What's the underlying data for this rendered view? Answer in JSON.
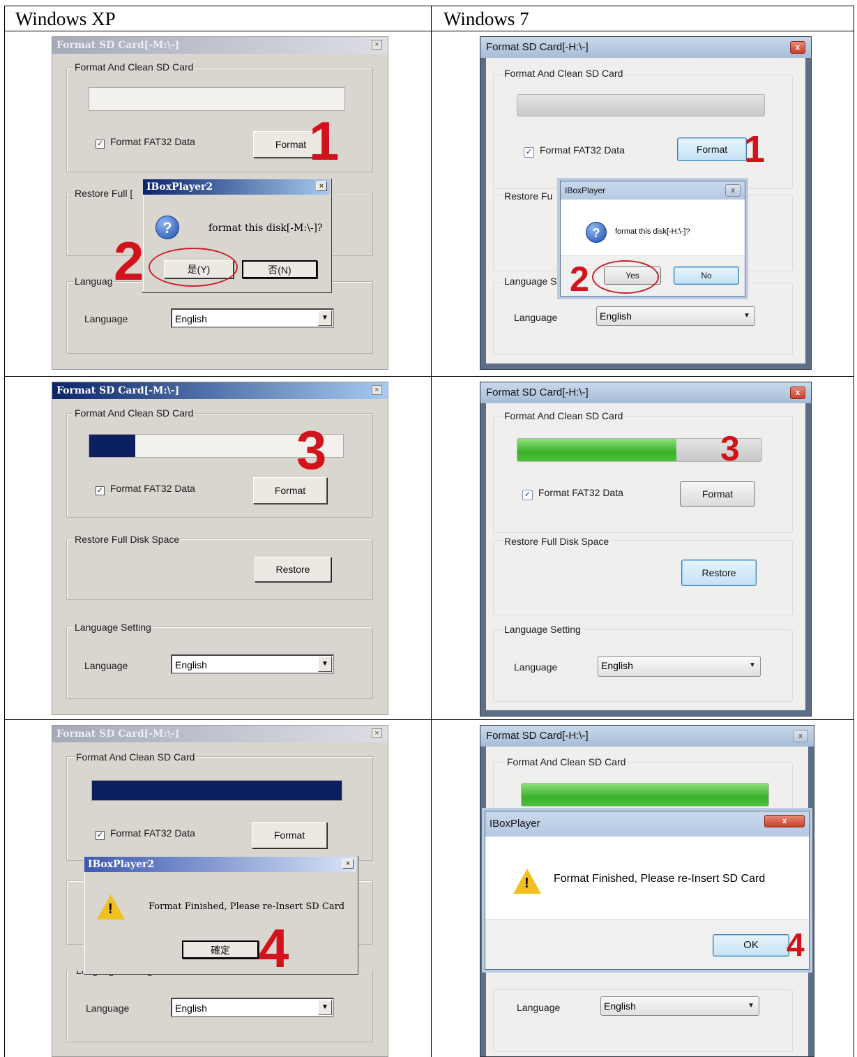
{
  "table": {
    "col_xp": "Windows XP",
    "col_w7": "Windows 7"
  },
  "xp": {
    "title": "Format SD Card[-M:\\-]",
    "group_format": "Format And Clean SD Card",
    "group_restore": "Restore Full Disk Space",
    "group_restore_partial": "Restore Full [",
    "group_language": "Language Setting",
    "group_language_partial1": "Languag",
    "group_language_partial3": "Language Setting",
    "checkbox_label": "Format FAT32 Data",
    "format_btn": "Format",
    "restore_btn": "Restore",
    "language_label": "Language",
    "language_value": "English",
    "progress_step3": 0.18,
    "progress_step4": 1.0,
    "dlg1": {
      "title": "IBoxPlayer2",
      "message": "format this disk[-M:\\-]?",
      "yes": "是(Y)",
      "no": "否(N)"
    },
    "dlg2": {
      "title": "IBoxPlayer2",
      "message": "Format Finished, Please re-Insert SD Card",
      "ok": "確定"
    }
  },
  "w7": {
    "title": "Format SD Card[-H:\\-]",
    "group_format": "Format And Clean SD Card",
    "group_restore": "Restore Full Disk Space",
    "group_restore_partial": "Restore Fu",
    "group_language": "Language Setting",
    "group_language_partial": "Language S",
    "checkbox_label": "Format FAT32 Data",
    "format_btn": "Format",
    "restore_btn": "Restore",
    "language_label": "Language",
    "language_value": "English",
    "progress_step3": 0.65,
    "progress_step4": 1.0,
    "dlg1": {
      "title": "IBoxPlayer",
      "message": "format this disk[-H:\\-]?",
      "yes": "Yes",
      "no": "No"
    },
    "dlg2": {
      "title": "IBoxPlayer",
      "message": "Format Finished, Please re-Insert SD Card",
      "ok": "OK"
    }
  },
  "steps": {
    "s1": "1",
    "s2": "2",
    "s3": "3",
    "s4": "4"
  },
  "icons": {
    "close": "x-icon",
    "question": "question-icon",
    "warning": "warning-icon",
    "dropdown": "dropdown-arrow-icon"
  },
  "colors": {
    "step_number": "#d2131b",
    "xp_progress": "#0a2060",
    "w7_progress": "#3ab02a"
  }
}
